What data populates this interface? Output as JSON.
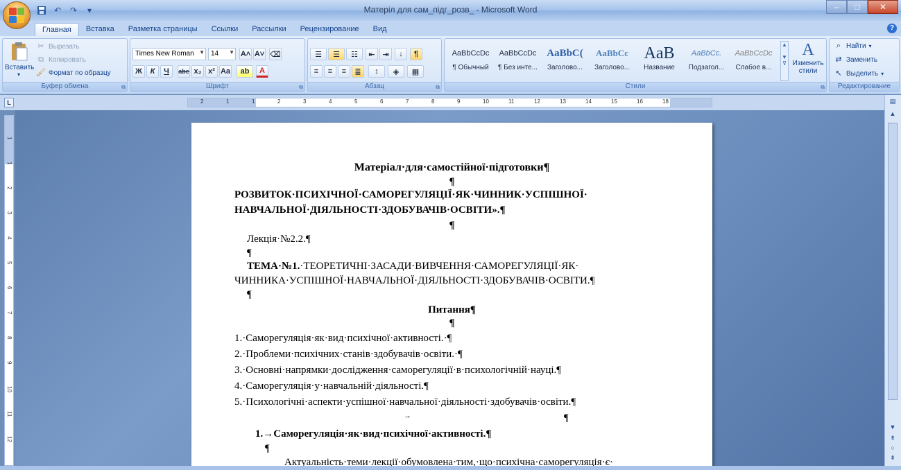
{
  "titlebar": {
    "title": "Матеріл для сам_підг_розв_ - Microsoft Word",
    "qat_icons": [
      "save-icon",
      "undo-icon",
      "redo-icon",
      "customize-icon"
    ],
    "minimize": "–",
    "maximize": "□",
    "close": "✕"
  },
  "tabs": [
    "Главная",
    "Вставка",
    "Разметка страницы",
    "Ссылки",
    "Рассылки",
    "Рецензирование",
    "Вид"
  ],
  "active_tab": "Главная",
  "ribbon": {
    "clipboard": {
      "paste": "Вставить",
      "cut": "Вырезать",
      "copy": "Копировать",
      "format_painter": "Формат по образцу",
      "label": "Буфер обмена"
    },
    "font": {
      "font_name": "Times New Roman",
      "font_size": "14",
      "label": "Шрифт",
      "bold": "Ж",
      "italic": "К",
      "underline": "Ч",
      "strike": "abe",
      "subscript": "x₂",
      "superscript": "x²",
      "case": "Aa",
      "grow": "A˄",
      "shrink": "A˅",
      "highlight": "ab",
      "color": "A"
    },
    "paragraph": {
      "label": "Абзац",
      "pilcrow": "¶"
    },
    "styles": {
      "label": "Стили",
      "items": [
        {
          "sample": "AaBbCcDc",
          "name": "¶ Обычный"
        },
        {
          "sample": "AaBbCcDc",
          "name": "¶ Без инте..."
        },
        {
          "sample": "AaBbC(",
          "name": "Заголово..."
        },
        {
          "sample": "AaBbCc",
          "name": "Заголово..."
        },
        {
          "sample": "AaB",
          "name": "Название"
        },
        {
          "sample": "AaBbCc.",
          "name": "Подзагол..."
        },
        {
          "sample": "AaBbCcDc",
          "name": "Слабое в..."
        }
      ],
      "change_styles": "Изменить стили"
    },
    "editing": {
      "label": "Редактирование",
      "find": "Найти",
      "replace": "Заменить",
      "select": "Выделить"
    }
  },
  "ruler": {
    "corner": "L",
    "numbers": [
      "2",
      "1",
      "1",
      "2",
      "3",
      "4",
      "5",
      "6",
      "7",
      "8",
      "9",
      "10",
      "11",
      "12",
      "13",
      "14",
      "15",
      "16",
      "18"
    ],
    "vnumbers": [
      "1",
      "1",
      "2",
      "3",
      "4",
      "5",
      "6",
      "7",
      "8",
      "9",
      "10",
      "11",
      "12"
    ]
  },
  "document": {
    "title": "Матеріал·для·самостійної·підготовки¶",
    "blank1": "¶",
    "heading_line1": "РОЗВИТОК·ПСИХІЧНОЇ·САМОРЕГУЛЯЦІЇ·ЯК·ЧИННИК·УСПІШНОЇ·",
    "heading_line2": "НАВЧАЛЬНОЇ·ДІЯЛЬНОСТІ·ЗДОБУВАЧІВ·ОСВІТИ».¶",
    "blank2": "¶",
    "lecture": "Лекція·№2.2.¶",
    "blank3": "¶",
    "topic_label": "ТЕМА·№1.",
    "topic_text": "·ТЕОРЕТИЧНІ·ЗАСАДИ·ВИВЧЕННЯ·САМОРЕГУЛЯЦІЇ·ЯК·",
    "topic_line2": "ЧИННИКА·УСПІШНОЇ·НАВЧАЛЬНОЇ·ДІЯЛЬНОСТІ·ЗДОБУВАЧІВ·ОСВІТИ.¶",
    "blank4": "¶",
    "questions_title": "Питання¶",
    "blank5": "¶",
    "questions": [
      "1.·Саморегуляція·як·вид·психічної·активності.·¶",
      "2.·Проблеми·психічних·станів·здобувачів·освіти.·¶",
      "3.·Основні·напрямки·дослідження·саморегуляції·в·психологічній·науці.¶",
      "4.·Саморегуляція·у·навчальній·діяльності.¶",
      "5.·Психологічні·аспекти·успішної·навчальної·діяльності·здобувачів·освіти.¶"
    ],
    "tab_arrow": "→",
    "blank6": "¶",
    "section_heading": "1.→Саморегуляція·як·вид·психічної·активності.¶",
    "blank7": "¶",
    "body_start": "Актуальність·теми·лекції·обумовлена·тим,·що·психічна·саморегуляція·є·"
  },
  "colors": {
    "ribbon_bg": "#d4e3f7",
    "workspace": "#6f8fb8",
    "text": "#15428b"
  }
}
